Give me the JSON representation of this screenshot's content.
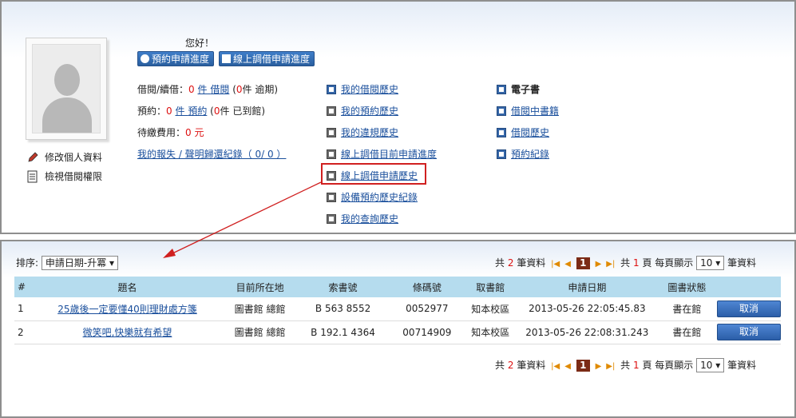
{
  "header": {
    "greeting": "您好！",
    "btn_reserve_progress": "預約申請進度",
    "btn_online_progress": "線上調借申請進度"
  },
  "profile": {
    "edit_label": "修改個人資料",
    "view_rights_label": "檢視借閱權限"
  },
  "stats": {
    "borrow_label": "借閱/續借：",
    "borrow_count": "0",
    "borrow_unit": "件",
    "borrow_link": "借閱",
    "overdue_open": "(",
    "overdue_count": "0",
    "overdue_text": "件 逾期)",
    "reserve_label": "預約：",
    "reserve_count": "0",
    "reserve_unit": "件",
    "reserve_link": "預約",
    "arrived_open": "(",
    "arrived_count": "0",
    "arrived_text": "件 已到館)",
    "fee_label": "待繳費用：",
    "fee_value": "0 元",
    "lost_link": "我的報失 / 聲明歸還紀錄（ 0/ 0 ）"
  },
  "history_links": [
    "我的借閱歷史",
    "我的預約歷史",
    "我的違規歷史",
    "線上調借目前申請進度",
    "線上調借申請歷史",
    "設備預約歷史紀錄",
    "我的查詢歷史"
  ],
  "ebook": {
    "title": "電子書",
    "links": [
      "借閱中書籍",
      "借閱歷史",
      "預約紀錄"
    ]
  },
  "list": {
    "sort_label": "排序:",
    "sort_value": "申請日期-升冪",
    "total_prefix": "共",
    "total_count": "2",
    "total_suffix": "筆資料",
    "page_prefix": "共",
    "page_total": "1",
    "page_suffix": "頁 每頁顯示",
    "current_page": "1",
    "per_page": "10",
    "per_page_suffix": "筆資料",
    "columns": [
      "#",
      "題名",
      "目前所在地",
      "索書號",
      "條碼號",
      "取書館",
      "申請日期",
      "圖書狀態",
      ""
    ],
    "rows": [
      {
        "no": "1",
        "title": "25歲後一定要懂40則理財處方箋",
        "location": "圖書館 總館",
        "call_no": "B 563 8552",
        "barcode": "0052977",
        "pickup": "知本校區",
        "date": "2013-05-26 22:05:45.83",
        "status": "書在館",
        "action": "取消"
      },
      {
        "no": "2",
        "title": "微笑吧,快樂就有希望",
        "location": "圖書館 總館",
        "call_no": "B 192.1 4364",
        "barcode": "00714909",
        "pickup": "知本校區",
        "date": "2013-05-26 22:08:31.243",
        "status": "書在館",
        "action": "取消"
      }
    ]
  },
  "colors": {
    "accent": "#1a4f9c",
    "header_row": "#b5dcee",
    "highlight": "#d02020"
  }
}
